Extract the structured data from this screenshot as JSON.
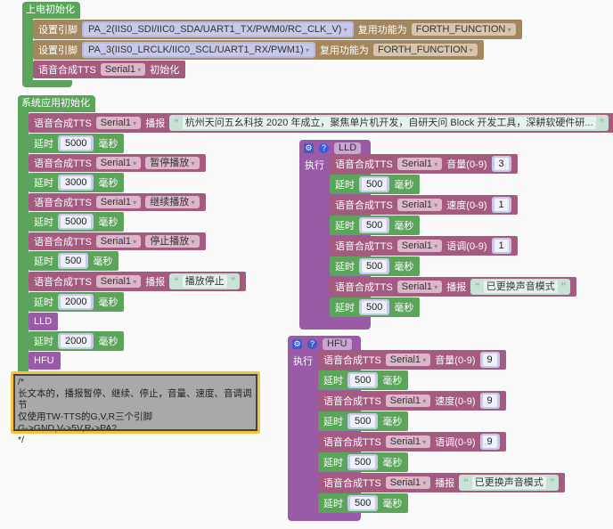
{
  "colors": {
    "control": "#5ba55b",
    "tts": "#a55b80",
    "pin": "#a5875e",
    "function": "#995ba5",
    "comment_border": "#f5c23a"
  },
  "power_init": {
    "title": "上电初始化",
    "statements": [
      {
        "kind": "p",
        "parts": [
          {
            "t": "text",
            "v": "设置引脚"
          },
          {
            "t": "pin",
            "v": "PA_2(IIS0_SDI/IIC0_SDA/UART1_TX/PWM0/RC_CLK_V)"
          },
          {
            "t": "text",
            "v": "复用功能为"
          },
          {
            "t": "fn",
            "v": "FORTH_FUNCTION"
          }
        ]
      },
      {
        "kind": "p",
        "parts": [
          {
            "t": "text",
            "v": "设置引脚"
          },
          {
            "t": "pin",
            "v": "PA_3(IIS0_LRCLK/IIC0_SCL/UART1_RX/PWM1)"
          },
          {
            "t": "text",
            "v": "复用功能为"
          },
          {
            "t": "fn",
            "v": "FORTH_FUNCTION"
          }
        ]
      },
      {
        "kind": "t",
        "parts": [
          {
            "t": "text",
            "v": "语音合成TTS"
          },
          {
            "t": "dd",
            "v": "Serial1"
          },
          {
            "t": "text",
            "v": "初始化"
          }
        ]
      }
    ]
  },
  "app_init": {
    "title": "系统应用初始化",
    "statements": [
      {
        "kind": "t",
        "parts": [
          {
            "t": "text",
            "v": "语音合成TTS"
          },
          {
            "t": "dd",
            "v": "Serial1"
          },
          {
            "t": "text",
            "v": "播报"
          },
          {
            "t": "str",
            "v": "杭州天问五幺科技 2020 年成立，聚焦单片机开发，自研天问 Block 开发工具，深耕软硬件研..."
          }
        ]
      },
      {
        "kind": "g",
        "parts": [
          {
            "t": "text",
            "v": "延时"
          },
          {
            "t": "num",
            "v": "5000"
          },
          {
            "t": "text",
            "v": "毫秒"
          }
        ]
      },
      {
        "kind": "t",
        "parts": [
          {
            "t": "text",
            "v": "语音合成TTS"
          },
          {
            "t": "dd",
            "v": "Serial1"
          },
          {
            "t": "dd",
            "v": "暂停播放"
          }
        ]
      },
      {
        "kind": "g",
        "parts": [
          {
            "t": "text",
            "v": "延时"
          },
          {
            "t": "num",
            "v": "3000"
          },
          {
            "t": "text",
            "v": "毫秒"
          }
        ]
      },
      {
        "kind": "t",
        "parts": [
          {
            "t": "text",
            "v": "语音合成TTS"
          },
          {
            "t": "dd",
            "v": "Serial1"
          },
          {
            "t": "dd",
            "v": "继续播放"
          }
        ]
      },
      {
        "kind": "g",
        "parts": [
          {
            "t": "text",
            "v": "延时"
          },
          {
            "t": "num",
            "v": "5000"
          },
          {
            "t": "text",
            "v": "毫秒"
          }
        ]
      },
      {
        "kind": "t",
        "parts": [
          {
            "t": "text",
            "v": "语音合成TTS"
          },
          {
            "t": "dd",
            "v": "Serial1"
          },
          {
            "t": "dd",
            "v": "停止播放"
          }
        ]
      },
      {
        "kind": "g",
        "parts": [
          {
            "t": "text",
            "v": "延时"
          },
          {
            "t": "num",
            "v": "500"
          },
          {
            "t": "text",
            "v": "毫秒"
          }
        ]
      },
      {
        "kind": "t",
        "parts": [
          {
            "t": "text",
            "v": "语音合成TTS"
          },
          {
            "t": "dd",
            "v": "Serial1"
          },
          {
            "t": "text",
            "v": "播报"
          },
          {
            "t": "str",
            "v": "播放停止"
          }
        ]
      },
      {
        "kind": "g",
        "parts": [
          {
            "t": "text",
            "v": "延时"
          },
          {
            "t": "num",
            "v": "2000"
          },
          {
            "t": "text",
            "v": "毫秒"
          }
        ]
      },
      {
        "kind": "f",
        "parts": [
          {
            "t": "text",
            "v": "LLD"
          }
        ]
      },
      {
        "kind": "g",
        "parts": [
          {
            "t": "text",
            "v": "延时"
          },
          {
            "t": "num",
            "v": "2000"
          },
          {
            "t": "text",
            "v": "毫秒"
          }
        ]
      },
      {
        "kind": "f",
        "parts": [
          {
            "t": "text",
            "v": "HFU"
          }
        ]
      }
    ]
  },
  "functions": [
    {
      "name": "LLD",
      "exec_label": "执行",
      "statements": [
        {
          "kind": "t",
          "parts": [
            {
              "t": "text",
              "v": "语音合成TTS"
            },
            {
              "t": "dd",
              "v": "Serial1"
            },
            {
              "t": "text",
              "v": "音量(0-9)"
            },
            {
              "t": "num",
              "v": "3"
            }
          ]
        },
        {
          "kind": "g",
          "parts": [
            {
              "t": "text",
              "v": "延时"
            },
            {
              "t": "num",
              "v": "500"
            },
            {
              "t": "text",
              "v": "毫秒"
            }
          ]
        },
        {
          "kind": "t",
          "parts": [
            {
              "t": "text",
              "v": "语音合成TTS"
            },
            {
              "t": "dd",
              "v": "Serial1"
            },
            {
              "t": "text",
              "v": "速度(0-9)"
            },
            {
              "t": "num",
              "v": "1"
            }
          ]
        },
        {
          "kind": "g",
          "parts": [
            {
              "t": "text",
              "v": "延时"
            },
            {
              "t": "num",
              "v": "500"
            },
            {
              "t": "text",
              "v": "毫秒"
            }
          ]
        },
        {
          "kind": "t",
          "parts": [
            {
              "t": "text",
              "v": "语音合成TTS"
            },
            {
              "t": "dd",
              "v": "Serial1"
            },
            {
              "t": "text",
              "v": "语调(0-9)"
            },
            {
              "t": "num",
              "v": "1"
            }
          ]
        },
        {
          "kind": "g",
          "parts": [
            {
              "t": "text",
              "v": "延时"
            },
            {
              "t": "num",
              "v": "500"
            },
            {
              "t": "text",
              "v": "毫秒"
            }
          ]
        },
        {
          "kind": "t",
          "parts": [
            {
              "t": "text",
              "v": "语音合成TTS"
            },
            {
              "t": "dd",
              "v": "Serial1"
            },
            {
              "t": "text",
              "v": "播报"
            },
            {
              "t": "str",
              "v": "已更换声音模式"
            }
          ]
        },
        {
          "kind": "g",
          "parts": [
            {
              "t": "text",
              "v": "延时"
            },
            {
              "t": "num",
              "v": "500"
            },
            {
              "t": "text",
              "v": "毫秒"
            }
          ]
        }
      ]
    },
    {
      "name": "HFU",
      "exec_label": "执行",
      "statements": [
        {
          "kind": "t",
          "parts": [
            {
              "t": "text",
              "v": "语音合成TTS"
            },
            {
              "t": "dd",
              "v": "Serial1"
            },
            {
              "t": "text",
              "v": "音量(0-9)"
            },
            {
              "t": "num",
              "v": "9"
            }
          ]
        },
        {
          "kind": "g",
          "parts": [
            {
              "t": "text",
              "v": "延时"
            },
            {
              "t": "num",
              "v": "500"
            },
            {
              "t": "text",
              "v": "毫秒"
            }
          ]
        },
        {
          "kind": "t",
          "parts": [
            {
              "t": "text",
              "v": "语音合成TTS"
            },
            {
              "t": "dd",
              "v": "Serial1"
            },
            {
              "t": "text",
              "v": "速度(0-9)"
            },
            {
              "t": "num",
              "v": "9"
            }
          ]
        },
        {
          "kind": "g",
          "parts": [
            {
              "t": "text",
              "v": "延时"
            },
            {
              "t": "num",
              "v": "500"
            },
            {
              "t": "text",
              "v": "毫秒"
            }
          ]
        },
        {
          "kind": "t",
          "parts": [
            {
              "t": "text",
              "v": "语音合成TTS"
            },
            {
              "t": "dd",
              "v": "Serial1"
            },
            {
              "t": "text",
              "v": "语调(0-9)"
            },
            {
              "t": "num",
              "v": "9"
            }
          ]
        },
        {
          "kind": "g",
          "parts": [
            {
              "t": "text",
              "v": "延时"
            },
            {
              "t": "num",
              "v": "500"
            },
            {
              "t": "text",
              "v": "毫秒"
            }
          ]
        },
        {
          "kind": "t",
          "parts": [
            {
              "t": "text",
              "v": "语音合成TTS"
            },
            {
              "t": "dd",
              "v": "Serial1"
            },
            {
              "t": "text",
              "v": "播报"
            },
            {
              "t": "str",
              "v": "已更换声音模式"
            }
          ]
        },
        {
          "kind": "g",
          "parts": [
            {
              "t": "text",
              "v": "延时"
            },
            {
              "t": "num",
              "v": "500"
            },
            {
              "t": "text",
              "v": "毫秒"
            }
          ]
        }
      ]
    }
  ],
  "comment": {
    "lines": [
      "/*",
      "长文本的，播报暂停、继续、停止，音量、速度、音调调节",
      "仅使用TW-TTS的G,V,R三个引脚",
      "G->GND,V->5V,R->PA2",
      "*/"
    ]
  }
}
